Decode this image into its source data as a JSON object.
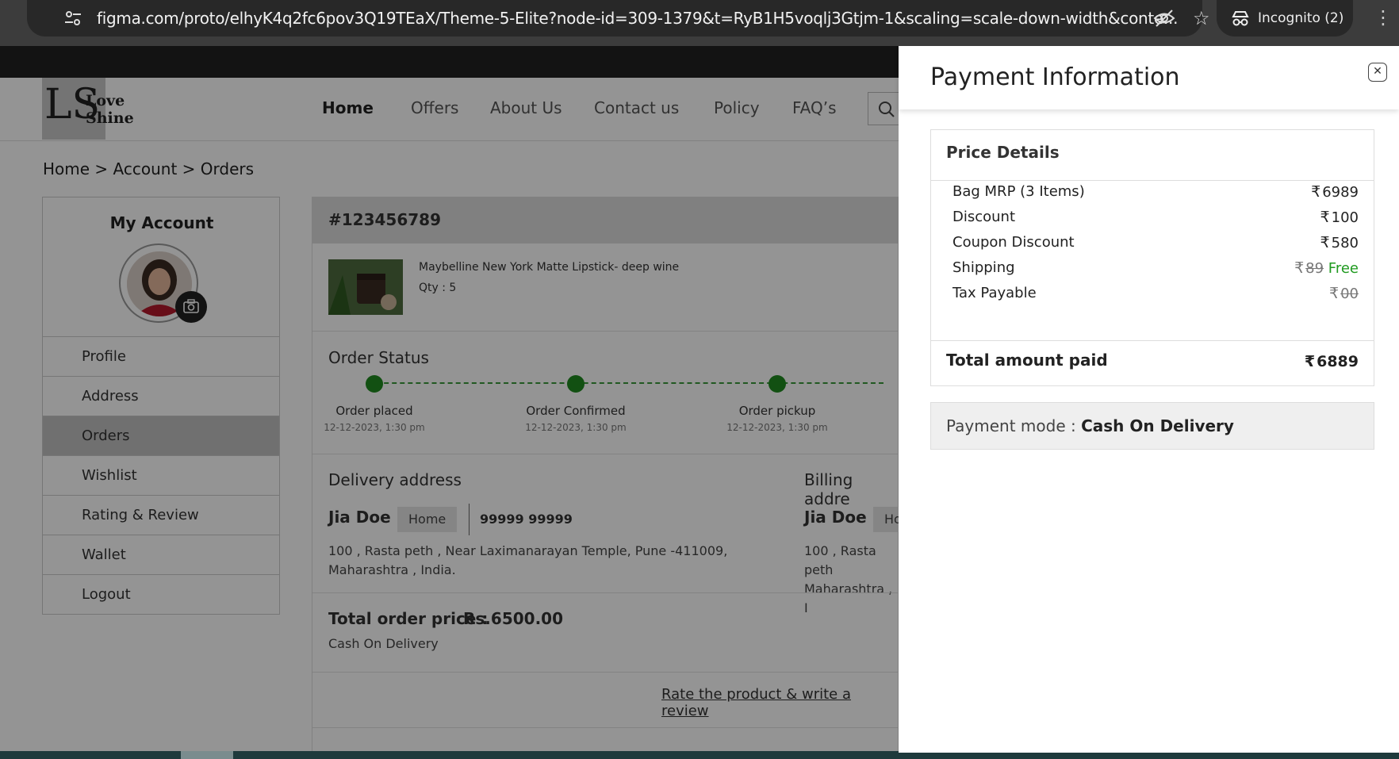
{
  "browser": {
    "url": "figma.com/proto/elhyK4q2fc6pov3Q19TEaX/Theme-5-Elite?node-id=309-1379&t=RyB1H5voqlj3Gtjm-1&scaling=scale-down-width&conte...",
    "incognito_label": "Incognito (2)"
  },
  "site": {
    "logo_letters": "LS",
    "logo_line1": "Love",
    "logo_line2": "Shine",
    "nav": [
      "Home",
      "Offers",
      "About Us",
      "Contact us",
      "Policy",
      "FAQ’s"
    ],
    "breadcrumb": "Home > Account > Orders"
  },
  "sidebar": {
    "title": "My Account",
    "items": [
      "Profile",
      "Address",
      "Orders",
      "Wishlist",
      "Rating & Review",
      "Wallet",
      "Logout"
    ],
    "active": "Orders"
  },
  "order": {
    "id": "#123456789",
    "product_name": "Maybelline New York Matte Lipstick-  deep wine",
    "qty": "Qty : 5",
    "status_title": "Order Status",
    "steps": [
      {
        "label": "Order placed",
        "date": "12-12-2023, 1:30 pm"
      },
      {
        "label": "Order Confirmed",
        "date": "12-12-2023, 1:30 pm"
      },
      {
        "label": "Order pickup",
        "date": "12-12-2023, 1:30 pm"
      }
    ],
    "delivery_title": "Delivery address",
    "billing_title": "Billing addre",
    "customer_name": "Jia Doe",
    "address_tag": "Home",
    "billing_tag": "Ho",
    "phone": "99999 99999",
    "address_line1": "100 , Rasta peth , Near Laximanarayan Temple, Pune -411009,",
    "address_line2": "Maharashtra , India.",
    "billing_line1": "100 , Rasta peth",
    "billing_line2": "Maharashtra , I",
    "total_label": "Total order price :",
    "total_value": "Rs.6500.00",
    "payment_method": "Cash On Delivery",
    "rate_link": "Rate the product & write a review"
  },
  "panel": {
    "title": "Payment Information",
    "price_title": "Price Details",
    "currency": "₹",
    "rows": {
      "bag_label": "Bag MRP (3 Items)",
      "bag_value": "6989",
      "discount_label": "Discount",
      "discount_value": "100",
      "coupon_label": "Coupon Discount",
      "coupon_value": "580",
      "shipping_label": "Shipping",
      "shipping_old": "89",
      "shipping_free": "Free",
      "tax_label": "Tax Payable",
      "tax_value": "00"
    },
    "total_label": "Total amount paid",
    "total_value": "6889",
    "paymode_label": "Payment mode : ",
    "paymode_value": "Cash On Delivery"
  },
  "colors": {
    "accent_green": "#1f9a1f",
    "overlay": "rgba(0,0,0,0.42)"
  }
}
